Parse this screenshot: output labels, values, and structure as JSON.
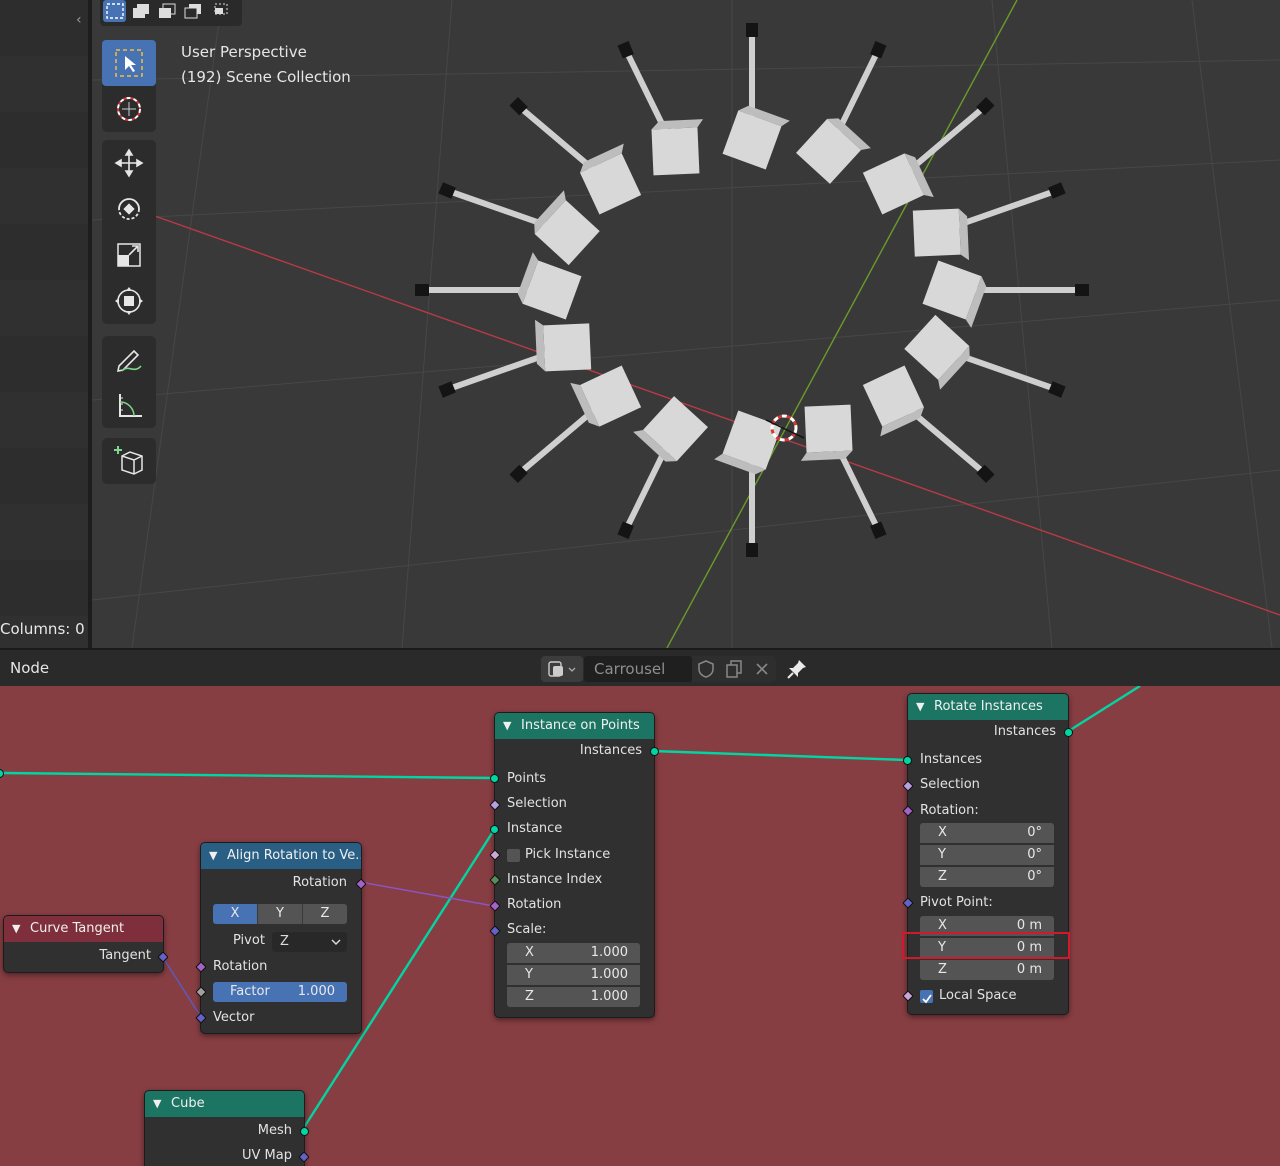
{
  "left_panel": {
    "columns_label": "Columns: 0"
  },
  "viewport": {
    "title_line1": "User Perspective",
    "title_line2": "(192) Scene Collection",
    "select_modes": [
      "select-box-icon",
      "mode-new-icon",
      "mode-extend-icon",
      "mode-subtract-icon",
      "mode-intersect-icon"
    ],
    "tools": [
      {
        "name": "select-box-tool",
        "icon": "cursor-select-icon",
        "active": true
      },
      {
        "name": "cursor-tool",
        "icon": "3d-cursor-icon",
        "active": false
      },
      {
        "name": "move-tool",
        "icon": "move-arrows-icon",
        "active": false
      },
      {
        "name": "rotate-tool",
        "icon": "rotate-icon",
        "active": false
      },
      {
        "name": "scale-tool",
        "icon": "scale-icon",
        "active": false
      },
      {
        "name": "transform-tool",
        "icon": "transform-icon",
        "active": false
      },
      {
        "name": "annotate-tool",
        "icon": "pencil-icon",
        "active": false
      },
      {
        "name": "measure-tool",
        "icon": "ruler-icon",
        "active": false
      },
      {
        "name": "add-cube-tool",
        "icon": "add-cube-icon",
        "active": false
      }
    ],
    "colors": {
      "background": "#393939",
      "x_axis": "#b83a46",
      "y_axis": "#6a9b2a",
      "cube": "#d8d8d8",
      "handle": "#111111"
    }
  },
  "node_header": {
    "menu_label": "Node",
    "tree_name": "Carrousel"
  },
  "nodes": {
    "instance_on_points": {
      "title": "Instance on Points",
      "output_instances": "Instances",
      "inputs": [
        "Points",
        "Selection",
        "Instance",
        "Pick Instance",
        "Instance Index",
        "Rotation",
        "Scale:"
      ],
      "scale": {
        "x_label": "X",
        "x": "1.000",
        "y_label": "Y",
        "y": "1.000",
        "z_label": "Z",
        "z": "1.000"
      }
    },
    "rotate_instances": {
      "title": "Rotate Instances",
      "output_instances": "Instances",
      "inputs": [
        "Instances",
        "Selection",
        "Rotation:"
      ],
      "rotation": {
        "x_label": "X",
        "x": "0°",
        "y_label": "Y",
        "y": "0°",
        "z_label": "Z",
        "z": "0°"
      },
      "pivot_label": "Pivot Point:",
      "pivot": {
        "x_label": "X",
        "x": "0 m",
        "y_label": "Y",
        "y": "0 m",
        "z_label": "Z",
        "z": "0 m"
      },
      "local_space": "Local Space"
    },
    "align_rotation": {
      "title": "Align Rotation to Ve...",
      "output_rotation": "Rotation",
      "axis": [
        "X",
        "Y",
        "Z"
      ],
      "pivot_label": "Pivot",
      "pivot_value": "Z",
      "input_rotation": "Rotation",
      "factor_label": "Factor",
      "factor_value": "1.000",
      "input_vector": "Vector"
    },
    "curve_tangent": {
      "title": "Curve Tangent",
      "output": "Tangent"
    },
    "cube": {
      "title": "Cube",
      "outputs": [
        "Mesh",
        "UV Map"
      ]
    }
  },
  "colors": {
    "editor_bg": "#873e43",
    "geometry_socket": "#00d6a3",
    "vector_socket": "#6363c7",
    "rotation_socket": "#a363c7",
    "highlight": "#d0192a"
  }
}
